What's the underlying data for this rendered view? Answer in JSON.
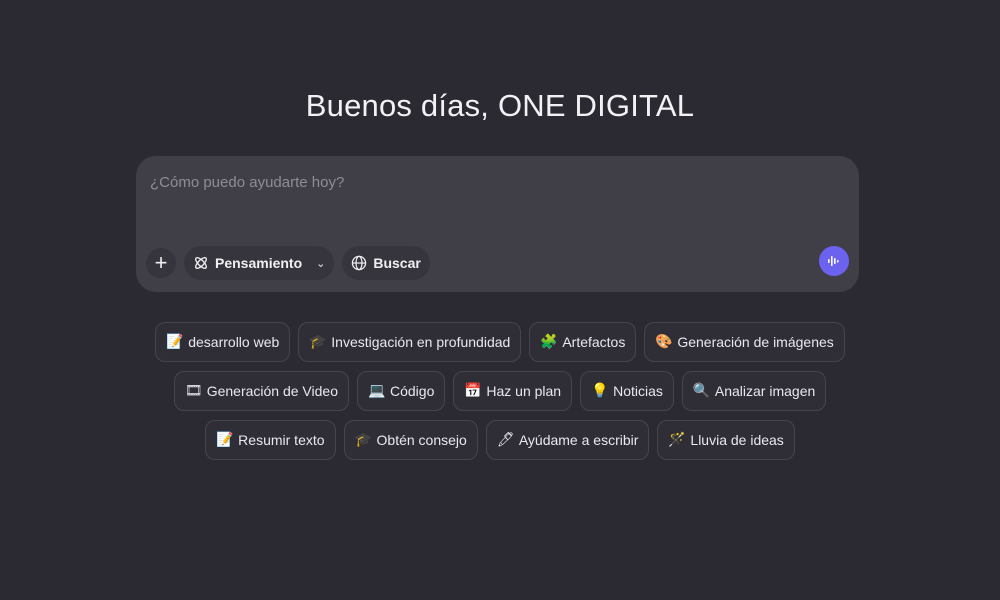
{
  "greeting": "Buenos días, ONE DIGITAL",
  "composer": {
    "placeholder": "¿Cómo puedo ayudarte hoy?",
    "add_icon": "plus-icon",
    "thinking_label": "Pensamiento",
    "search_label": "Buscar",
    "voice_icon": "voice-waveform-icon"
  },
  "colors": {
    "background": "#2b2a33",
    "composer": "#403f48",
    "accent": "#6b63f0"
  },
  "suggestions": {
    "row1": [
      {
        "icon": "📝",
        "label": "desarrollo web"
      },
      {
        "icon": "🎓",
        "label": "Investigación en profundidad"
      },
      {
        "icon": "🧩",
        "label": "Artefactos"
      },
      {
        "icon": "🎨",
        "label": "Generación de imágenes"
      }
    ],
    "row2": [
      {
        "icon": "🎞",
        "label": "Generación de Video"
      },
      {
        "icon": "💻",
        "label": "Código"
      },
      {
        "icon": "📅",
        "label": "Haz un plan"
      },
      {
        "icon": "💡",
        "label": "Noticias"
      },
      {
        "icon": "🔍",
        "label": "Analizar imagen"
      }
    ],
    "row3": [
      {
        "icon": "📝",
        "label": "Resumir texto"
      },
      {
        "icon": "🎓",
        "label": "Obtén consejo"
      },
      {
        "icon": "🖊",
        "label": "Ayúdame a escribir"
      },
      {
        "icon": "🪄",
        "label": "Lluvia de ideas"
      }
    ]
  }
}
